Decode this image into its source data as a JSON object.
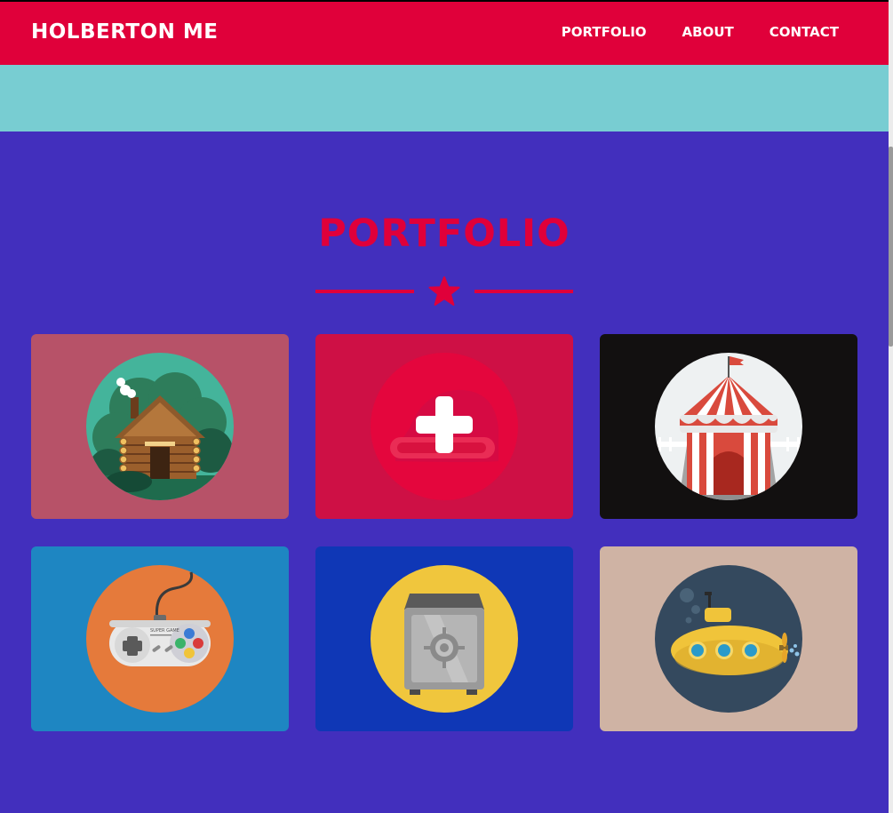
{
  "navbar": {
    "brand": "HOLBERTON ME",
    "links": [
      "PORTFOLIO",
      "ABOUT",
      "CONTACT"
    ]
  },
  "portfolio": {
    "title": "PORTFOLIO",
    "items": [
      {
        "icon": "log-cabin-icon",
        "bg": "#b75268"
      },
      {
        "icon": "add-icon",
        "bg": "#ce1045"
      },
      {
        "icon": "circus-tent-icon",
        "bg": "#121010"
      },
      {
        "icon": "game-controller-icon",
        "bg": "#1e86c2"
      },
      {
        "icon": "safe-icon",
        "bg": "#0f37b6"
      },
      {
        "icon": "submarine-icon",
        "bg": "#cfb3a4"
      }
    ],
    "gamepad_label": "SUPER GAME"
  },
  "colors": {
    "accent": "#e0003a",
    "band": "#78cdd2",
    "background": "#422fbd"
  }
}
